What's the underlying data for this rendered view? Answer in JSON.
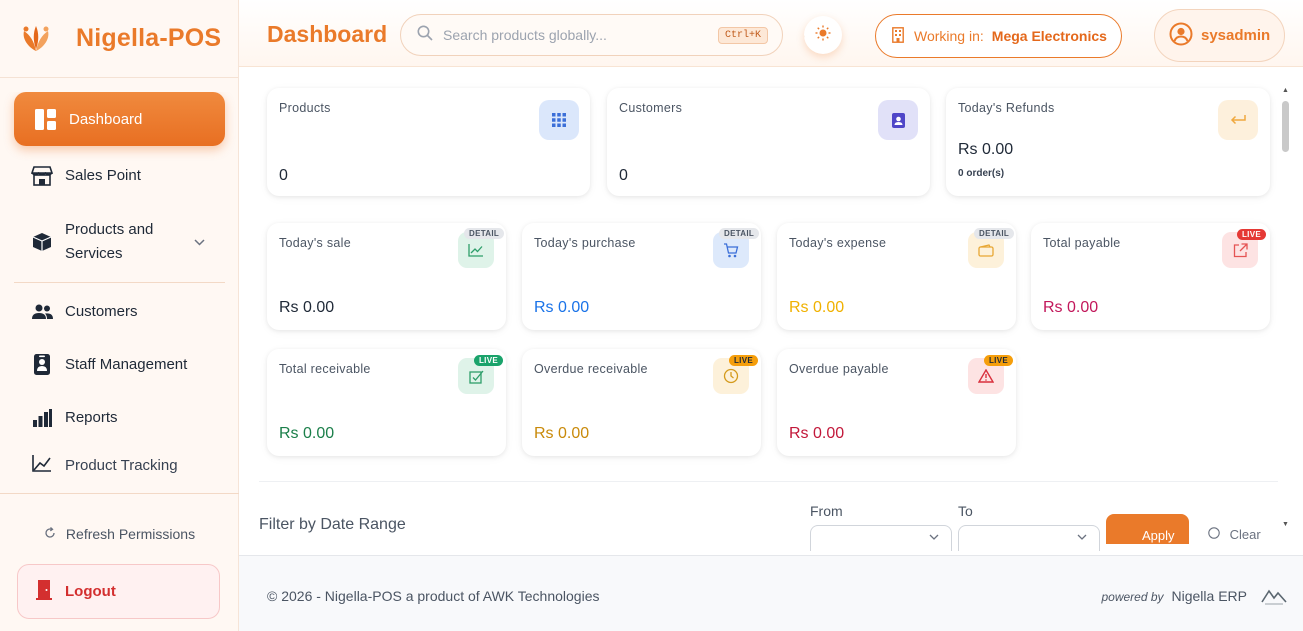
{
  "brand": {
    "name": "Nigella-POS"
  },
  "sidebar": {
    "items": [
      {
        "label": "Dashboard"
      },
      {
        "label": "Sales Point"
      },
      {
        "label": "Products and",
        "label2": "Services"
      },
      {
        "label": "Customers"
      },
      {
        "label": "Staff Management"
      },
      {
        "label": "Reports"
      },
      {
        "label": "Product Tracking"
      }
    ],
    "refresh_label": "Refresh Permissions",
    "logout_label": "Logout"
  },
  "header": {
    "title": "Dashboard",
    "search_placeholder": "Search products globally...",
    "search_shortcut": "Ctrl+K",
    "workspace_label": "Working in:",
    "workspace_name": "Mega Electronics",
    "username": "sysadmin"
  },
  "stats_top": [
    {
      "title": "Products",
      "value": "0"
    },
    {
      "title": "Customers",
      "value": "0"
    },
    {
      "title": "Today's Refunds",
      "value": "Rs 0.00",
      "sub": "0 order(s)"
    }
  ],
  "stats_mid": [
    {
      "title": "Today's sale",
      "value": "Rs 0.00",
      "badge": "DETAIL"
    },
    {
      "title": "Today's purchase",
      "value": "Rs 0.00",
      "badge": "DETAIL"
    },
    {
      "title": "Today's expense",
      "value": "Rs 0.00",
      "badge": "DETAIL"
    },
    {
      "title": "Total payable",
      "value": "Rs 0.00",
      "badge": "LIVE"
    }
  ],
  "stats_bottom": [
    {
      "title": "Total receivable",
      "value": "Rs 0.00",
      "badge": "LIVE"
    },
    {
      "title": "Overdue receivable",
      "value": "Rs 0.00",
      "badge": "LIVE"
    },
    {
      "title": "Overdue payable",
      "value": "Rs 0.00",
      "badge": "LIVE"
    }
  ],
  "filter": {
    "title": "Filter by Date Range",
    "from_label": "From",
    "to_label": "To",
    "apply_label": "Apply",
    "clear_label": "Clear"
  },
  "footer": {
    "copyright": "© 2026 - Nigella-POS a product of AWK Technologies",
    "powered_by": "powered by",
    "erp_name": "Nigella ERP"
  },
  "colors": {
    "accent": "#ea7a2a",
    "blue_value": "#1a73e8",
    "amber_value": "#f0b100",
    "red_value": "#c2185b",
    "green_value": "#1b7f4a",
    "gold_value": "#c98a0a",
    "crimson_value": "#c2183a"
  }
}
